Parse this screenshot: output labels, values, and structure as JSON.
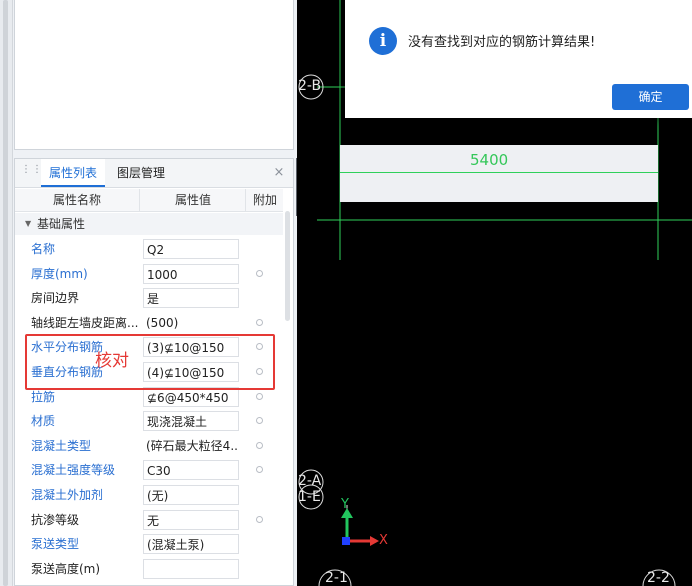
{
  "panel": {
    "tab_properties": "属性列表",
    "tab_layers": "图层管理",
    "close_symbol": "×",
    "col_name": "属性名称",
    "col_value": "属性值",
    "col_add": "附加",
    "group_label": "基础属性",
    "rows": [
      {
        "name": "名称",
        "value": "Q2",
        "blue": true,
        "box": true,
        "dot": false
      },
      {
        "name": "厚度(mm)",
        "value": "1000",
        "blue": true,
        "box": true,
        "dot": true
      },
      {
        "name": "房间边界",
        "value": "是",
        "blue": false,
        "box": true,
        "dot": false
      },
      {
        "name": "轴线距左墙皮距离...",
        "value": "(500)",
        "blue": false,
        "box": false,
        "dot": true
      },
      {
        "name": "水平分布钢筋",
        "value": "(3)⊈10@150",
        "blue": true,
        "box": true,
        "dot": true
      },
      {
        "name": "垂直分布钢筋",
        "value": "(4)⊈10@150",
        "blue": true,
        "box": true,
        "dot": true
      },
      {
        "name": "拉筋",
        "value": "⊈6@450*450",
        "blue": true,
        "box": true,
        "dot": true
      },
      {
        "name": "材质",
        "value": "现浇混凝土",
        "blue": true,
        "box": true,
        "dot": true
      },
      {
        "name": "混凝土类型",
        "value": "(碎石最大粒径4...",
        "blue": true,
        "box": false,
        "dot": true
      },
      {
        "name": "混凝土强度等级",
        "value": "C30",
        "blue": true,
        "box": true,
        "dot": true
      },
      {
        "name": "混凝土外加剂",
        "value": "(无)",
        "blue": true,
        "box": true,
        "dot": false
      },
      {
        "name": "抗渗等级",
        "value": "无",
        "blue": false,
        "box": true,
        "dot": true
      },
      {
        "name": "泵送类型",
        "value": "(混凝土泵)",
        "blue": true,
        "box": true,
        "dot": false
      },
      {
        "name": "泵送高度(m)",
        "value": "",
        "blue": false,
        "box": true,
        "dot": false
      }
    ],
    "annotation": "核对"
  },
  "dialog": {
    "message": "没有查找到对应的钢筋计算结果!",
    "ok_label": "确定"
  },
  "canvas": {
    "dimension": "5400",
    "axis_2B": "2-B",
    "axis_2A": "2-A",
    "axis_1E": "1-E",
    "axis_21": "2-1",
    "axis_22": "2-2",
    "coord_y": "Y",
    "coord_x": "X"
  },
  "colors": {
    "accent": "#1f6fd6",
    "dim_green": "#34c759",
    "annotation_red": "#e53935"
  }
}
